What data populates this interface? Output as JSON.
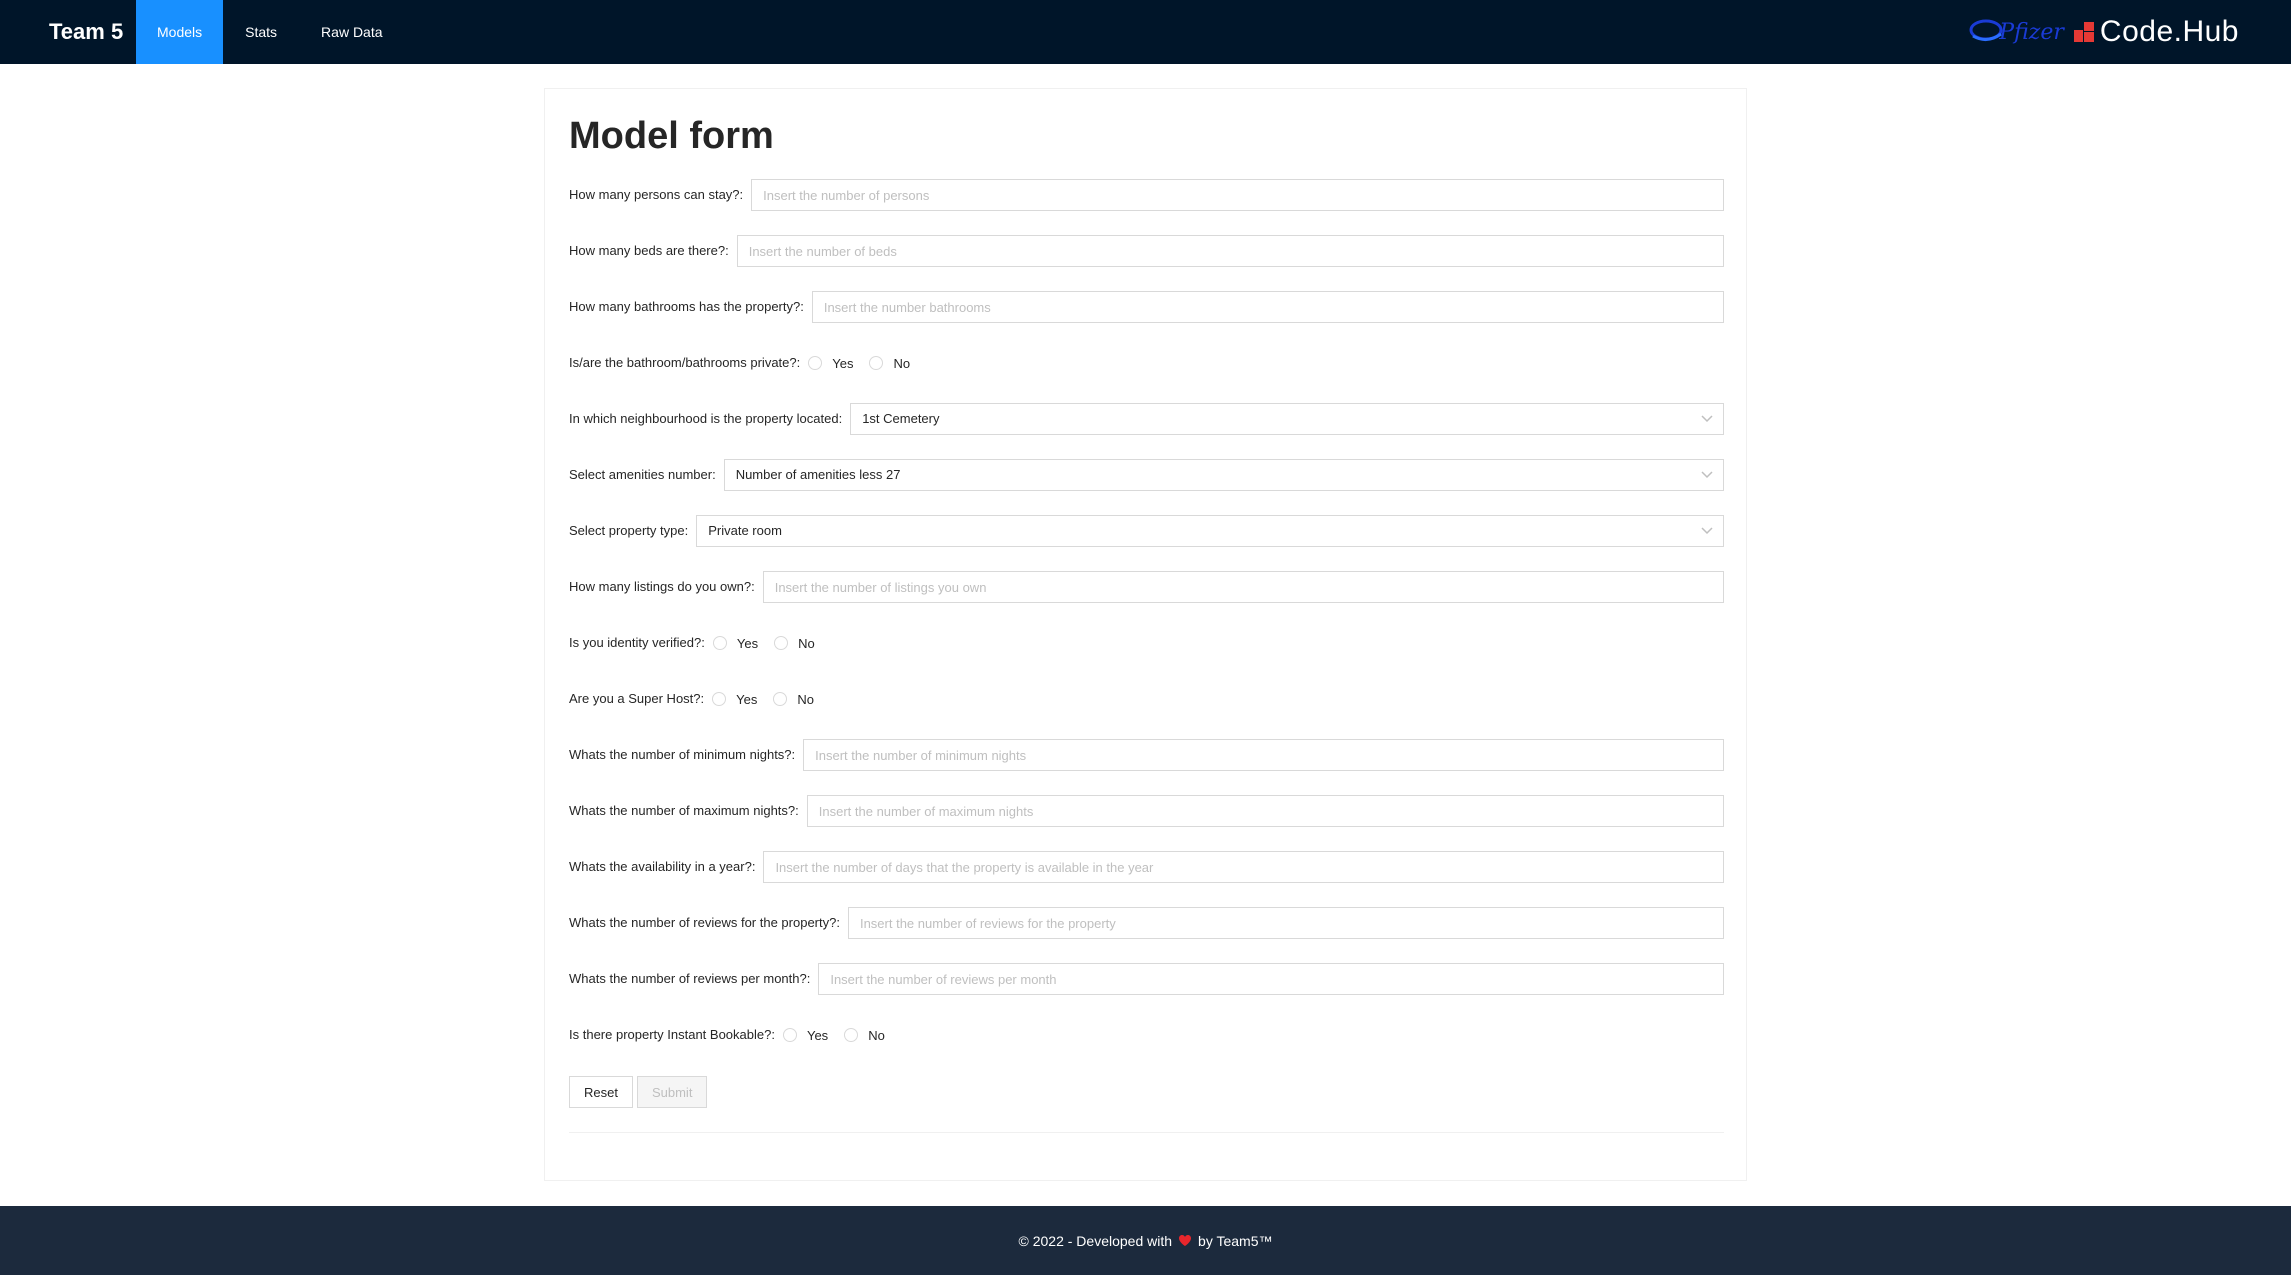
{
  "header": {
    "brand": "Team 5",
    "nav": [
      {
        "label": "Models",
        "active": true
      },
      {
        "label": "Stats",
        "active": false
      },
      {
        "label": "Raw Data",
        "active": false
      }
    ],
    "logos": {
      "pfizer": "Pfizer",
      "codehub": "Code.Hub"
    }
  },
  "form": {
    "title": "Model form",
    "persons": {
      "label": "How many persons can stay?:",
      "placeholder": "Insert the number of persons"
    },
    "beds": {
      "label": "How many beds are there?:",
      "placeholder": "Insert the number of beds"
    },
    "bathrooms": {
      "label": "How many bathrooms has the property?:",
      "placeholder": "Insert the number bathrooms"
    },
    "bath_private": {
      "label": "Is/are the bathroom/bathrooms private?:",
      "yes": "Yes",
      "no": "No"
    },
    "neighbourhood": {
      "label": "In which neighbourhood is the property located:",
      "value": "1st Cemetery"
    },
    "amenities": {
      "label": "Select amenities number:",
      "value": "Number of amenities less 27"
    },
    "property_type": {
      "label": "Select property type:",
      "value": "Private room"
    },
    "listings": {
      "label": "How many listings do you own?:",
      "placeholder": "Insert the number of listings you own"
    },
    "identity": {
      "label": "Is you identity verified?:",
      "yes": "Yes",
      "no": "No"
    },
    "superhost": {
      "label": "Are you a Super Host?:",
      "yes": "Yes",
      "no": "No"
    },
    "min_nights": {
      "label": "Whats the number of minimum nights?:",
      "placeholder": "Insert the number of minimum nights"
    },
    "max_nights": {
      "label": "Whats the number of maximum nights?:",
      "placeholder": "Insert the number of maximum nights"
    },
    "availability": {
      "label": "Whats the availability in a year?:",
      "placeholder": "Insert the number of days that the property is available in the year"
    },
    "reviews": {
      "label": "Whats the number of reviews for the property?:",
      "placeholder": "Insert the number of reviews for the property"
    },
    "reviews_month": {
      "label": "Whats the number of reviews per month?:",
      "placeholder": "Insert the number of reviews per month"
    },
    "instant": {
      "label": "Is there property Instant Bookable?:",
      "yes": "Yes",
      "no": "No"
    },
    "reset_label": "Reset",
    "submit_label": "Submit"
  },
  "footer": {
    "prefix": "© 2022 - Developed with",
    "suffix": "by Team5™"
  },
  "colors": {
    "header_bg": "#001529",
    "active_nav": "#1890ff",
    "footer_bg": "#1c2a3d",
    "heart": "#e8262c"
  }
}
